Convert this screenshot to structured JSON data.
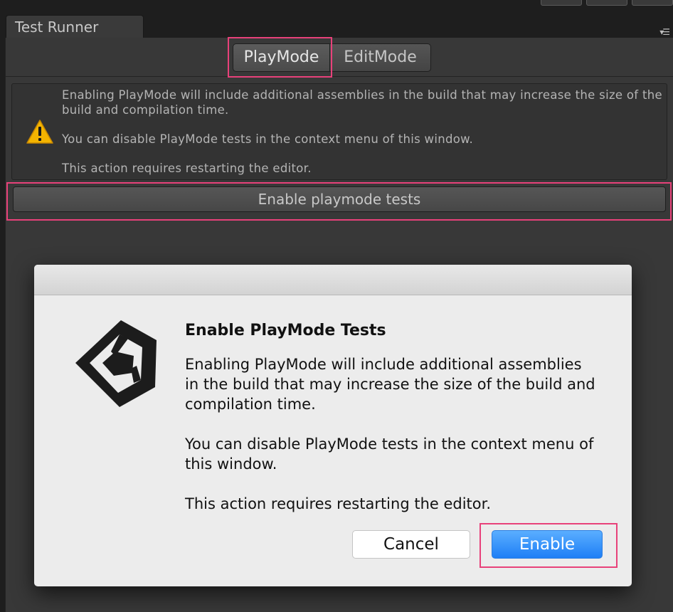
{
  "window": {
    "tab_title": "Test Runner"
  },
  "mode_tabs": {
    "playmode_label": "PlayMode",
    "editmode_label": "EditMode",
    "active": "PlayMode"
  },
  "warning": {
    "icon": "warning-triangle-icon",
    "line1": "Enabling PlayMode will include additional assemblies in the build that may increase the size of the build and compilation time.",
    "line2": "You can disable PlayMode tests in the context menu of this window.",
    "line3": "This action requires restarting the editor."
  },
  "enable_playmode_button_label": "Enable playmode tests",
  "dialog": {
    "logo": "unity-logo-icon",
    "heading": "Enable PlayMode Tests",
    "paragraph1": "Enabling PlayMode will include additional assemblies in the build that may increase the size of the build and compilation time.",
    "paragraph2": "You can disable PlayMode tests in the context menu of this window.",
    "paragraph3": "This action requires restarting the editor.",
    "cancel_label": "Cancel",
    "enable_label": "Enable"
  },
  "colors": {
    "highlight": "#e8417a",
    "primary_button": "#2f86f6",
    "panel_bg": "#383838"
  }
}
